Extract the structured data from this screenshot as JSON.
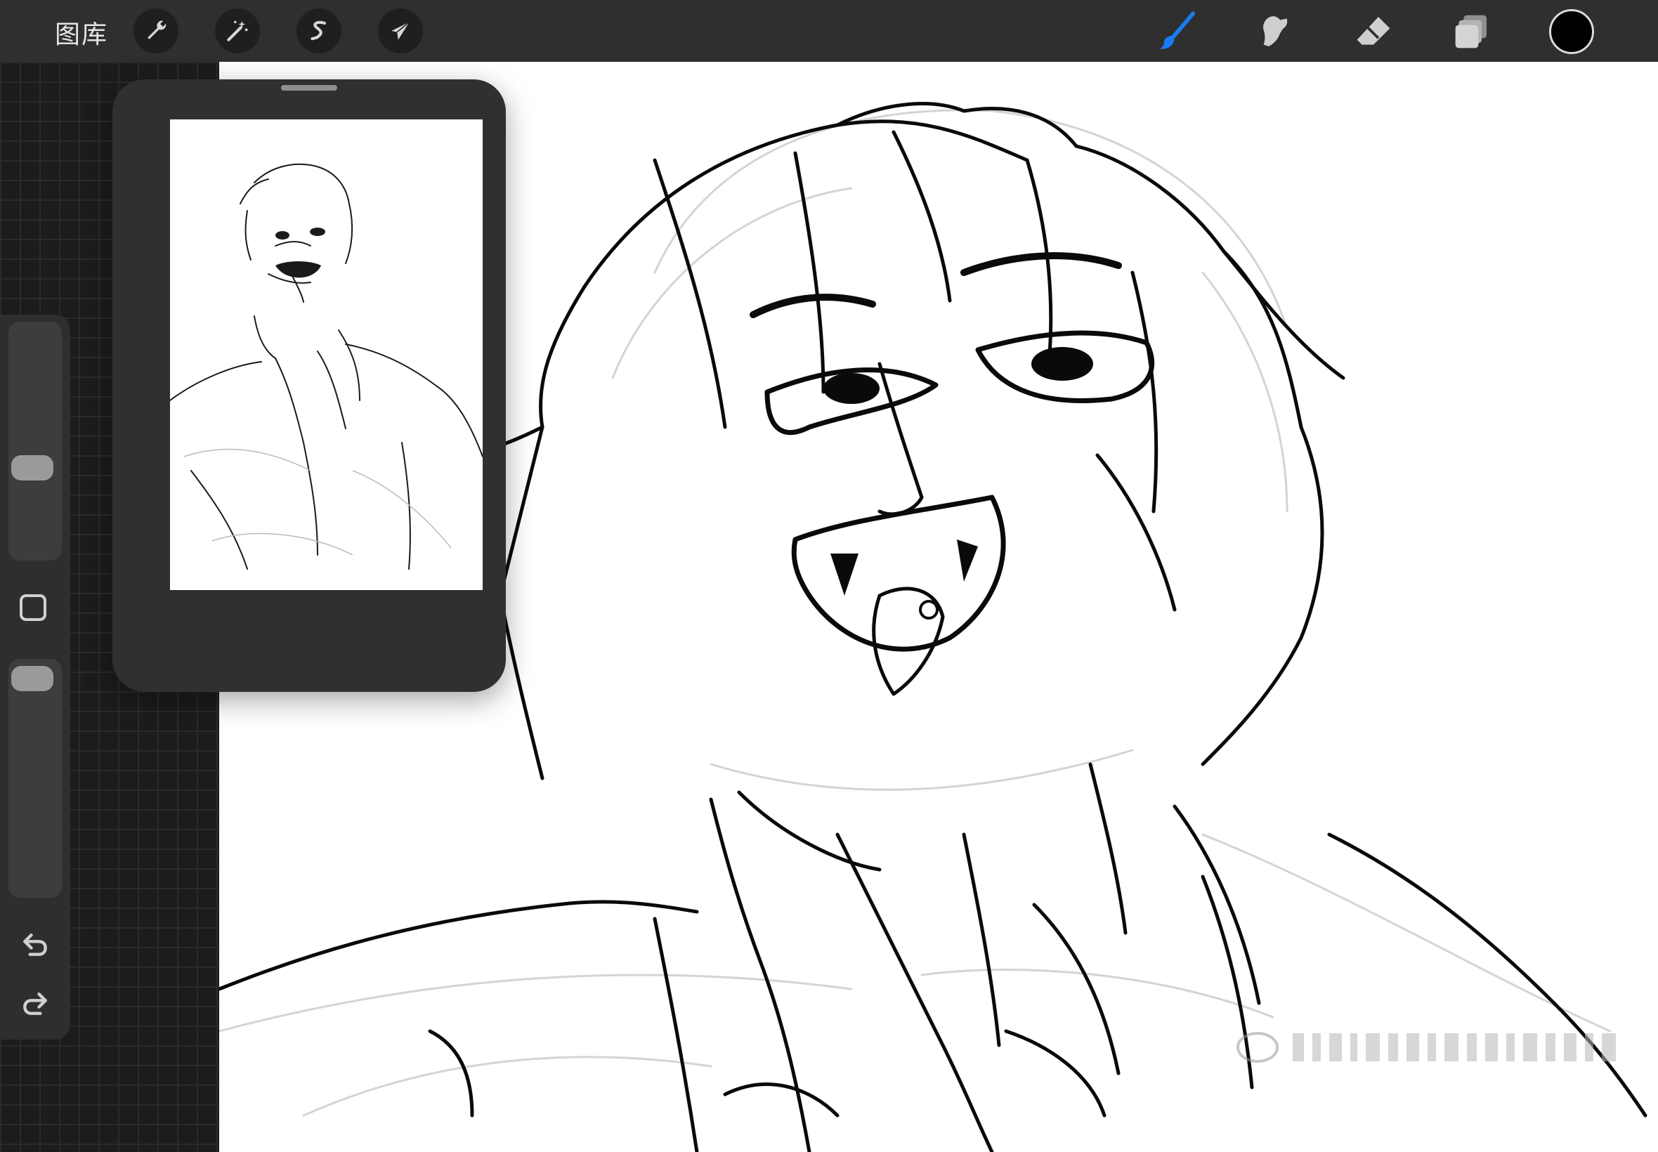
{
  "app": {
    "gallery_label": "图库"
  },
  "toolbar": {
    "left_tools": [
      {
        "name": "actions",
        "icon": "wrench-icon"
      },
      {
        "name": "adjustments",
        "icon": "magic-wand-icon"
      },
      {
        "name": "selection",
        "icon": "selection-s-icon"
      },
      {
        "name": "transform",
        "icon": "arrow-cursor-icon"
      }
    ],
    "right_tools": [
      {
        "name": "brush",
        "icon": "brush-icon",
        "active": true
      },
      {
        "name": "smudge",
        "icon": "smudge-icon"
      },
      {
        "name": "eraser",
        "icon": "eraser-icon"
      },
      {
        "name": "layers",
        "icon": "layers-icon"
      }
    ],
    "active_color": "#000000",
    "accent_color": "#1a7cf5"
  },
  "sidebar": {
    "brush_size_level": 0.38,
    "opacity_level": 0.95
  }
}
